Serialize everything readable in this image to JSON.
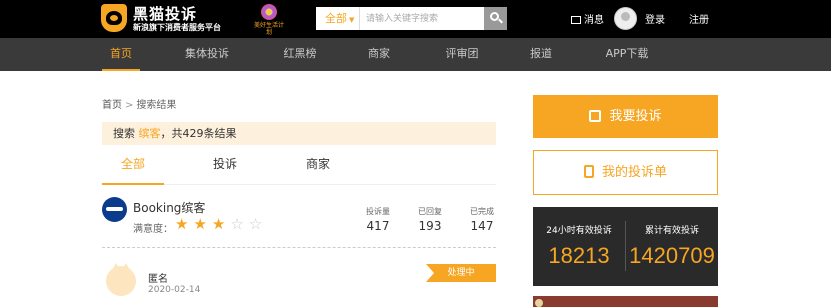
{
  "header": {
    "brand": "黑猫投诉",
    "slogan": "新浪旗下消费者服务平台",
    "partner_text": "美好生活计划",
    "search": {
      "scope": "全部",
      "placeholder": "请输入关键字搜索"
    },
    "messages": "消息",
    "login": "登录",
    "register": "注册"
  },
  "nav": {
    "items": [
      {
        "label": "首页",
        "active": true
      },
      {
        "label": "集体投诉",
        "active": false
      },
      {
        "label": "红黑榜",
        "active": false
      },
      {
        "label": "商家",
        "active": false
      },
      {
        "label": "评审团",
        "active": false
      },
      {
        "label": "报道",
        "active": false
      },
      {
        "label": "APP下载",
        "active": false
      }
    ]
  },
  "breadcrumb": {
    "home": "首页",
    "separator": ">",
    "current": "搜索结果"
  },
  "result": {
    "prefix": "搜索",
    "keyword": "缤客",
    "suffix": "，共429条结果"
  },
  "tabs": [
    {
      "label": "全部",
      "active": true
    },
    {
      "label": "投诉",
      "active": false
    },
    {
      "label": "商家",
      "active": false
    }
  ],
  "merchant": {
    "name": "Booking缤客",
    "satisfaction_label": "满意度：",
    "rating": 3,
    "rating_max": 5,
    "stats": [
      {
        "label": "投诉量",
        "value": "417"
      },
      {
        "label": "已回复",
        "value": "193"
      },
      {
        "label": "已完成",
        "value": "147"
      }
    ]
  },
  "complaint": {
    "user": "匿名",
    "date": "2020-02-14",
    "status": "处理中"
  },
  "sidebar": {
    "complain_button": "我要投诉",
    "my_list_button": "我的投诉单",
    "stats": [
      {
        "label": "24小时有效投诉",
        "value": "18213"
      },
      {
        "label": "累计有效投诉",
        "value": "1420709"
      }
    ]
  },
  "colors": {
    "accent": "#f6a623",
    "topbar": "#000000",
    "nav": "#3a3a3a",
    "result_bg": "#fdf0dc",
    "stats_bg": "#2a2a2a"
  }
}
